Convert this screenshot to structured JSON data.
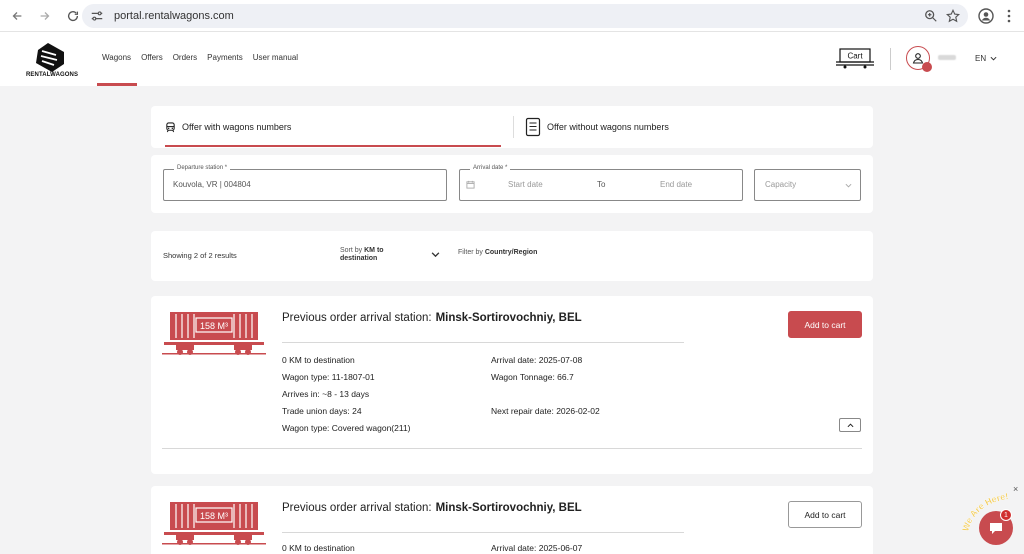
{
  "browser": {
    "url": "portal.rentalwagons.com"
  },
  "header": {
    "logo_text": "RENTALWAGONS",
    "nav": [
      "Wagons",
      "Offers",
      "Orders",
      "Payments",
      "User manual"
    ],
    "active_nav": "Wagons",
    "cart_label": "Cart",
    "language": "EN"
  },
  "tabs": {
    "with_numbers": "Offer with wagons numbers",
    "without_numbers": "Offer without wagons numbers"
  },
  "search": {
    "departure_label": "Departure station *",
    "departure_value": "Kouvola, VR | 004804",
    "arrival_label": "Arrival date *",
    "start_placeholder": "Start date",
    "to_label": "To",
    "end_placeholder": "End date",
    "capacity_placeholder": "Capacity"
  },
  "filter": {
    "showing": "Showing 2 of 2 results",
    "sort_prefix": "Sort by ",
    "sort_value": "KM to destination",
    "filter_prefix": "Filter by ",
    "filter_value": "Country/Region"
  },
  "results": [
    {
      "capacity_label": "158 M³",
      "prev_label": "Previous order arrival station:",
      "prev_station": "Minsk-Sortirovochniy, BEL",
      "button": "Add to cart",
      "km": "0 KM to destination",
      "wagon_type_code": "Wagon type: 11-1807-01",
      "arrives": "Arrives in: ~8 - 13 days",
      "trade_union": "Trade union days: 24",
      "wagon_type": "Wagon type: Covered wagon(211)",
      "arrival_date": "Arrival date: 2025-07-08",
      "tonnage": "Wagon Tonnage: 66.7",
      "next_repair": "Next repair date: 2026-02-02"
    },
    {
      "capacity_label": "158 M³",
      "prev_label": "Previous order arrival station:",
      "prev_station": "Minsk-Sortirovochniy, BEL",
      "button": "Add to cart",
      "km": "0 KM to destination",
      "arrival_date": "Arrival date: 2025-06-07"
    }
  ],
  "chat": {
    "close": "×",
    "text": "We Are Here!",
    "badge": "1"
  },
  "colors": {
    "accent": "#c84b4f"
  }
}
